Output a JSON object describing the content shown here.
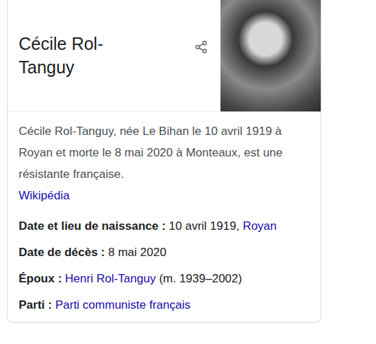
{
  "panel": {
    "title": "Cécile Rol-Tanguy",
    "description": "Cécile Rol-Tanguy, née Le Bihan le 10 avril 1919 à Royan et morte le 8 mai 2020 à Monteaux, est une résistante française.",
    "source": "Wikipédia"
  },
  "facts": [
    {
      "label": "Date et lieu de naissance :",
      "parts": [
        {
          "text": "10 avril 1919, ",
          "link": false
        },
        {
          "text": "Royan",
          "link": true
        }
      ]
    },
    {
      "label": "Date de décès :",
      "parts": [
        {
          "text": "8 mai 2020",
          "link": false
        }
      ]
    },
    {
      "label": "Époux :",
      "parts": [
        {
          "text": "Henri Rol-Tanguy",
          "link": true
        },
        {
          "text": " (m. 1939–2002)",
          "link": false
        }
      ]
    },
    {
      "label": "Parti :",
      "parts": [
        {
          "text": "Parti communiste français",
          "link": true
        }
      ]
    }
  ]
}
